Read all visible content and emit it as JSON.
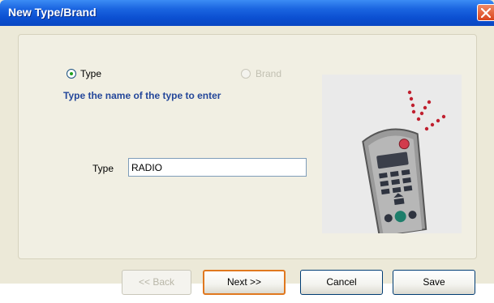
{
  "window": {
    "title": "New Type/Brand"
  },
  "options": [
    {
      "label": "Type",
      "selected": true,
      "enabled": true
    },
    {
      "label": "Brand",
      "selected": false,
      "enabled": false
    }
  ],
  "instruction": "Type the name of the type to enter",
  "field": {
    "label": "Type",
    "value": "RADIO",
    "placeholder": ""
  },
  "illustration": {
    "icon": "remote-control-icon"
  },
  "buttons": {
    "back": "<< Back",
    "next": "Next >>",
    "cancel": "Cancel",
    "save": "Save"
  },
  "colors": {
    "title_bar": "#0b4fd1",
    "instruction_text": "#24479a",
    "default_button_border": "#e0781f",
    "close_button": "#d9431b"
  }
}
